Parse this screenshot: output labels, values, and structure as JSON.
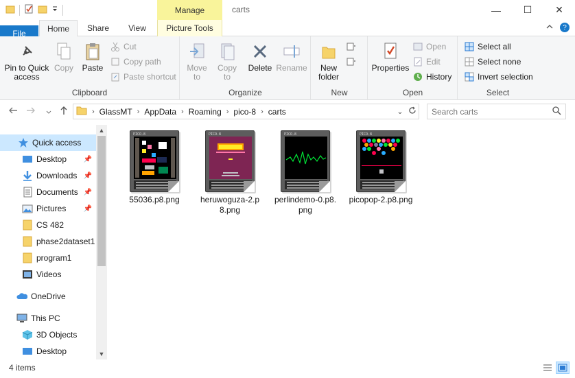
{
  "window": {
    "title": "carts",
    "manage_label": "Manage",
    "minimize": "—",
    "maximize": "☐",
    "close": "✕"
  },
  "ribbon_tabs": {
    "file": "File",
    "home": "Home",
    "share": "Share",
    "view": "View",
    "picture_tools": "Picture Tools"
  },
  "ribbon": {
    "clipboard": {
      "label": "Clipboard",
      "pin_to_quick_access": "Pin to Quick access",
      "copy": "Copy",
      "paste": "Paste",
      "cut": "Cut",
      "copy_path": "Copy path",
      "paste_shortcut": "Paste shortcut"
    },
    "organize": {
      "label": "Organize",
      "move_to": "Move to",
      "copy_to": "Copy to",
      "delete": "Delete",
      "rename": "Rename"
    },
    "new": {
      "label": "New",
      "new_folder": "New folder"
    },
    "open": {
      "label": "Open",
      "properties": "Properties",
      "open": "Open",
      "edit": "Edit",
      "history": "History"
    },
    "select": {
      "label": "Select",
      "select_all": "Select all",
      "select_none": "Select none",
      "invert_selection": "Invert selection"
    }
  },
  "address": {
    "crumbs": [
      "GlassMT",
      "AppData",
      "Roaming",
      "pico-8",
      "carts"
    ]
  },
  "search": {
    "placeholder": "Search carts"
  },
  "sidebar": {
    "items": [
      {
        "label": "Quick access",
        "icon": "star-icon",
        "pinned": false
      },
      {
        "label": "Desktop",
        "icon": "desktop-icon",
        "pinned": true
      },
      {
        "label": "Downloads",
        "icon": "download-icon",
        "pinned": true
      },
      {
        "label": "Documents",
        "icon": "documents-icon",
        "pinned": true
      },
      {
        "label": "Pictures",
        "icon": "pictures-icon",
        "pinned": true
      },
      {
        "label": "CS 482",
        "icon": "folder-icon",
        "pinned": false
      },
      {
        "label": "phase2dataset1",
        "icon": "folder-icon",
        "pinned": false
      },
      {
        "label": "program1",
        "icon": "folder-icon",
        "pinned": false
      },
      {
        "label": "Videos",
        "icon": "videos-icon",
        "pinned": false
      },
      {
        "label": "OneDrive",
        "icon": "cloud-icon",
        "pinned": false
      },
      {
        "label": "This PC",
        "icon": "computer-icon",
        "pinned": false
      },
      {
        "label": "3D Objects",
        "icon": "cube-icon",
        "pinned": false
      },
      {
        "label": "Desktop",
        "icon": "desktop-icon",
        "pinned": false
      }
    ]
  },
  "files": [
    {
      "name": "55036.p8.png"
    },
    {
      "name": "heruwoguza-2.p8.png"
    },
    {
      "name": "perlindemo-0.p8.png"
    },
    {
      "name": "picopop-2.p8.png"
    }
  ],
  "status": {
    "count": "4 items"
  },
  "colors": {
    "accent": "#1979ca",
    "manage": "#f9f49b",
    "selection": "#cce8ff"
  }
}
